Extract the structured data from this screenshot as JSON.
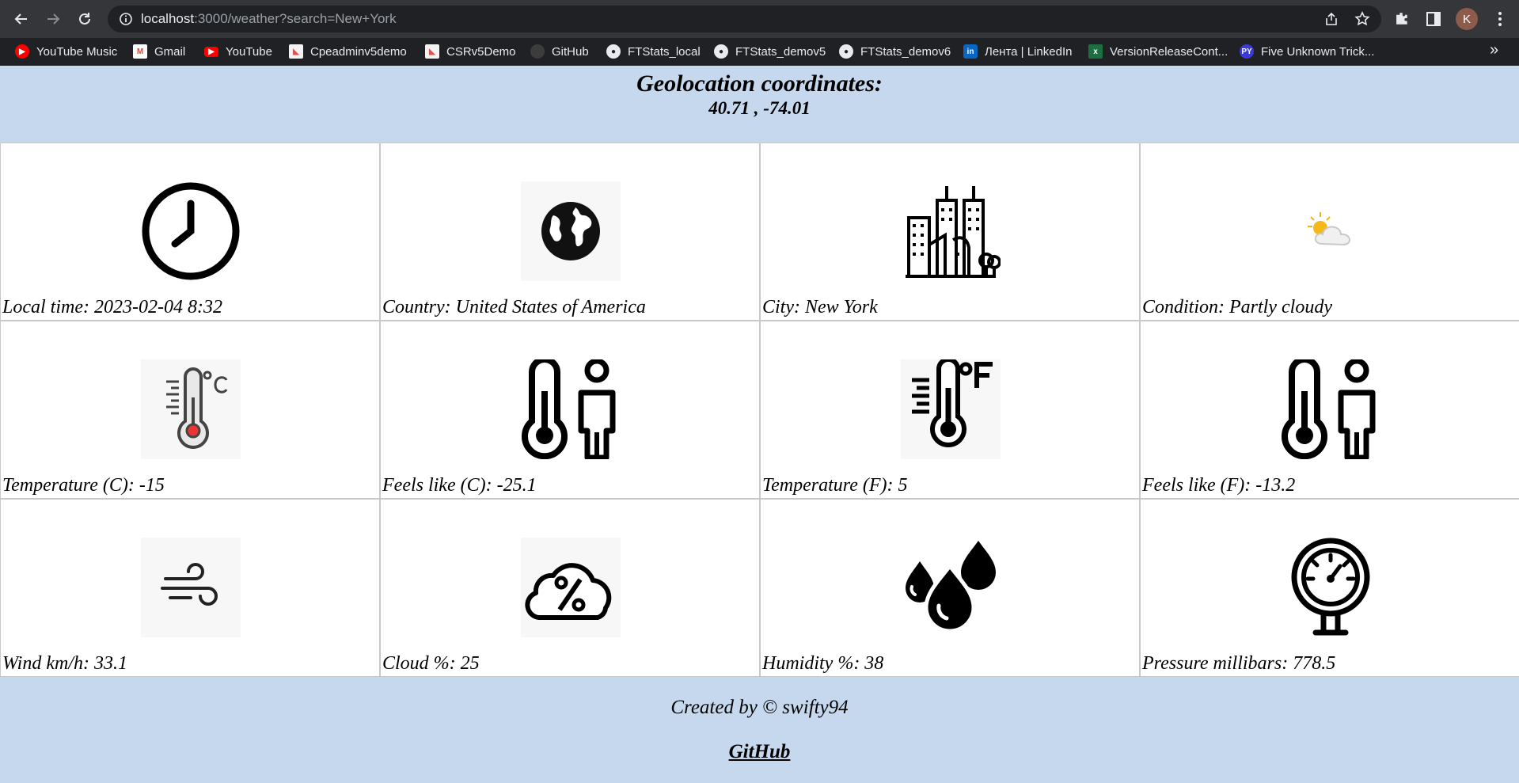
{
  "browser": {
    "url_host": "localhost",
    "url_rest": ":3000/weather?search=New+York",
    "avatar_letter": "K",
    "bookmarks": [
      {
        "label": "YouTube Music",
        "icon": "youtube-music-icon",
        "color": "#ff0000"
      },
      {
        "label": "Gmail",
        "icon": "gmail-icon",
        "color": "#ea4335"
      },
      {
        "label": "YouTube",
        "icon": "youtube-icon",
        "color": "#ff0000"
      },
      {
        "label": "Cpeadminv5demo",
        "icon": "app-logo-icon",
        "color": "#d9534f"
      },
      {
        "label": "CSRv5Demo",
        "icon": "app-logo-icon",
        "color": "#d9534f"
      },
      {
        "label": "GitHub",
        "icon": "github-icon",
        "color": "#3c3c3c"
      },
      {
        "label": "FTStats_local",
        "icon": "globe-icon",
        "color": "#e8eaed"
      },
      {
        "label": "FTStats_demov5",
        "icon": "globe-icon",
        "color": "#e8eaed"
      },
      {
        "label": "FTStats_demov6",
        "icon": "globe-icon",
        "color": "#e8eaed"
      },
      {
        "label": "Лента | LinkedIn",
        "icon": "linkedin-icon",
        "color": "#0a66c2"
      },
      {
        "label": "VersionReleaseCont...",
        "icon": "excel-icon",
        "color": "#1d6f42"
      },
      {
        "label": "Five Unknown Trick...",
        "icon": "py-icon",
        "color": "#3b3bd4"
      }
    ],
    "overflow": "»"
  },
  "header": {
    "title": "Geolocation coordinates:",
    "coords": "40.71 , -74.01"
  },
  "cards": [
    {
      "icon": "clock-icon",
      "label": "Local time: 2023-02-04 8:32"
    },
    {
      "icon": "globe-icon",
      "label": "Country: United States of America"
    },
    {
      "icon": "city-icon",
      "label": "City: New York"
    },
    {
      "icon": "partly-cloudy-icon",
      "label": "Condition: Partly cloudy"
    },
    {
      "icon": "thermometer-celsius-icon",
      "label": "Temperature (C): -15"
    },
    {
      "icon": "feels-like-icon",
      "label": "Feels like (C): -25.1"
    },
    {
      "icon": "thermometer-fahrenheit-icon",
      "label": "Temperature (F): 5"
    },
    {
      "icon": "feels-like-icon",
      "label": "Feels like (F): -13.2"
    },
    {
      "icon": "wind-icon",
      "label": "Wind km/h: 33.1"
    },
    {
      "icon": "cloud-percent-icon",
      "label": "Cloud %: 25"
    },
    {
      "icon": "humidity-drops-icon",
      "label": "Humidity %: 38"
    },
    {
      "icon": "pressure-gauge-icon",
      "label": "Pressure millibars: 778.5"
    }
  ],
  "footer": {
    "credit": "Created by © swifty94",
    "link": "GitHub"
  }
}
